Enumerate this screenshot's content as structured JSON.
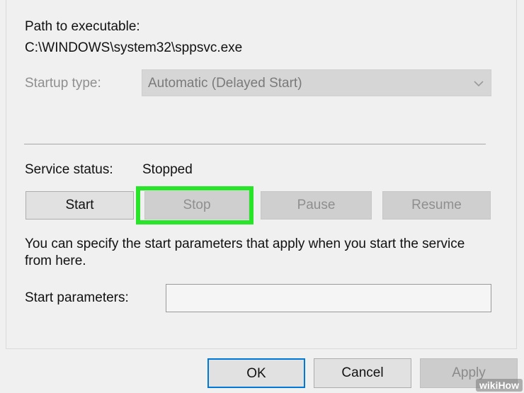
{
  "properties": {
    "path_label": "Path to executable:",
    "path_value": "C:\\WINDOWS\\system32\\sppsvc.exe",
    "startup_type_label": "Startup type:",
    "startup_type_value": "Automatic (Delayed Start)",
    "service_status_label": "Service status:",
    "service_status_value": "Stopped",
    "buttons": {
      "start": "Start",
      "stop": "Stop",
      "pause": "Pause",
      "resume": "Resume"
    },
    "help_text_line1": "You can specify the start parameters that apply when you start the service",
    "help_text_line2": "from here.",
    "start_params_label": "Start parameters:",
    "start_params_value": ""
  },
  "footer": {
    "ok": "OK",
    "cancel": "Cancel",
    "apply": "Apply"
  },
  "watermark": "wikiHow",
  "colors": {
    "highlight": "#29e529",
    "ok_border": "#0078d7"
  },
  "icons": {
    "dropdown": "chevron-down-icon"
  }
}
